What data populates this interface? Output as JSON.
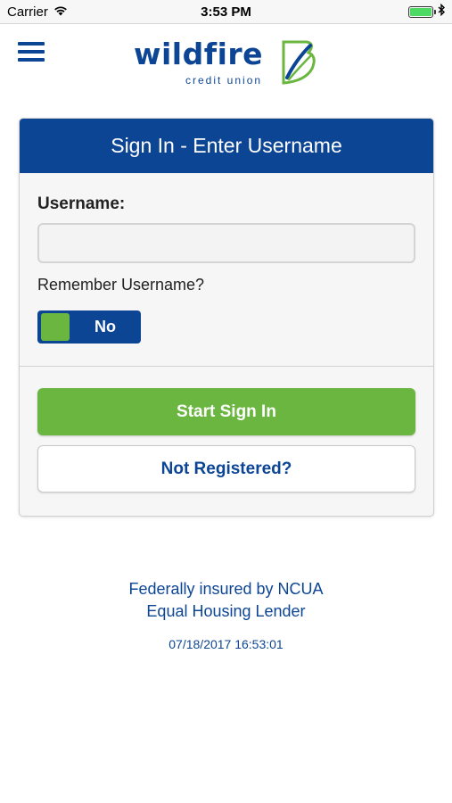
{
  "status_bar": {
    "carrier": "Carrier",
    "time": "3:53 PM",
    "wifi_icon": "wifi-icon",
    "bluetooth_icon": "bluetooth-icon",
    "battery_icon": "battery-icon",
    "battery_level": 1.0
  },
  "header": {
    "menu_icon": "hamburger-menu-icon",
    "logo_word": "wildfire",
    "logo_sub": "credit union"
  },
  "signin": {
    "title": "Sign In - Enter Username",
    "username_label": "Username:",
    "username_value": "",
    "username_placeholder": "",
    "remember_label": "Remember Username?",
    "remember_toggle": "No",
    "start_button": "Start Sign In",
    "register_button": "Not Registered?"
  },
  "footer": {
    "line1": "Federally insured by NCUA",
    "line2": "Equal Housing Lender",
    "timestamp": "07/18/2017 16:53:01"
  },
  "colors": {
    "brand_blue": "#0d4595",
    "brand_green": "#6ab640",
    "card_bg": "#f6f6f6"
  }
}
